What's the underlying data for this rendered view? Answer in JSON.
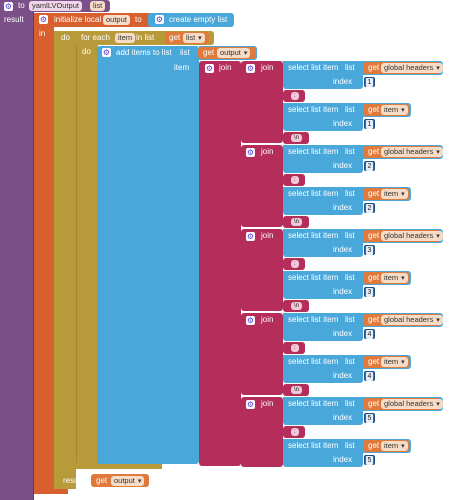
{
  "procedure": {
    "to": "to",
    "name": "yamlLVOutput",
    "param": "list",
    "result": "result"
  },
  "local": {
    "label": "initialize local",
    "var": "output",
    "to": "to",
    "in": "in",
    "init": "create empty list"
  },
  "loop": {
    "do": "do",
    "for_each": "for each",
    "var": "item",
    "in_list": "in list",
    "get": "get",
    "list": "list",
    "do2": "do"
  },
  "add": {
    "label": "add items to list",
    "list": "list",
    "get": "get",
    "var": "output",
    "item": "item"
  },
  "join": "join",
  "pair": {
    "select": "select list item",
    "list": "list",
    "index": "index",
    "get": "get",
    "headers": "global headers",
    "item": "item",
    "sep": ": ",
    "newline": "\\n"
  },
  "rows": [
    {
      "index": "1",
      "sep": ": ",
      "nl": "\\n"
    },
    {
      "index": "2",
      "sep": ": ",
      "nl": "\\n"
    },
    {
      "index": "3",
      "sep": ": ",
      "nl": "\\n"
    },
    {
      "index": "4",
      "sep": ": ",
      "nl": "\\n"
    },
    {
      "index": "5",
      "sep": ": ",
      "nl": ""
    }
  ],
  "footer": {
    "result": "result",
    "get": "get",
    "var": "output"
  },
  "colors": {
    "procedure": "#7b4f87",
    "local": "#d8602e",
    "loop": "#b89a3a",
    "list": "#4aa7d9",
    "text": "#b42d5b",
    "variable": "#e0793a"
  }
}
